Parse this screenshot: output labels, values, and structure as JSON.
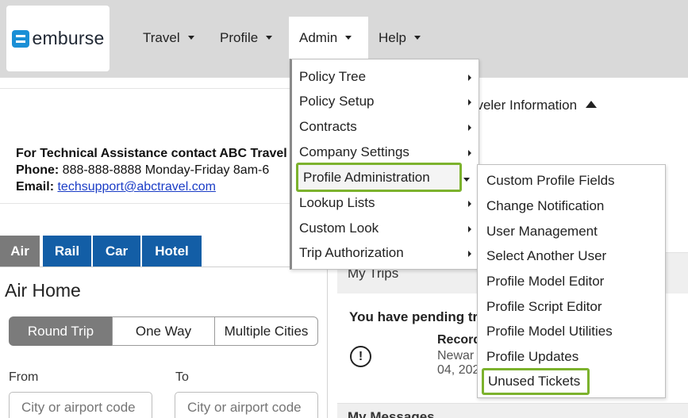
{
  "brand": {
    "name": "emburse",
    "color": "#1a8fd6"
  },
  "nav": {
    "items": [
      {
        "label": "Travel"
      },
      {
        "label": "Profile"
      },
      {
        "label": "Admin"
      },
      {
        "label": "Help"
      }
    ]
  },
  "admin_menu": {
    "items": [
      {
        "label": "Policy Tree"
      },
      {
        "label": "Policy Setup"
      },
      {
        "label": "Contracts"
      },
      {
        "label": "Company Settings"
      },
      {
        "label": "Profile Administration"
      },
      {
        "label": "Lookup Lists"
      },
      {
        "label": "Custom Look"
      },
      {
        "label": "Trip Authorization"
      }
    ],
    "highlight_color": "#7cb22d"
  },
  "profile_admin_submenu": {
    "items": [
      {
        "label": "Custom Profile Fields"
      },
      {
        "label": "Change Notification"
      },
      {
        "label": "User Management"
      },
      {
        "label": "Select Another User"
      },
      {
        "label": "Profile Model Editor"
      },
      {
        "label": "Profile Script Editor"
      },
      {
        "label": "Profile Model Utilities"
      },
      {
        "label": "Profile Updates"
      },
      {
        "label": "Unused Tickets"
      }
    ]
  },
  "traveler_info": {
    "label": "aveler Information"
  },
  "support": {
    "line1": "For Technical Assistance contact ABC Travel",
    "phone_label": "Phone:",
    "phone_value": "888-888-8888 Monday-Friday 8am-6",
    "email_label": "Email:",
    "email_value": "techsupport@abctravel.com"
  },
  "tabs": [
    {
      "label": "Air"
    },
    {
      "label": "Rail"
    },
    {
      "label": "Car"
    },
    {
      "label": "Hotel"
    }
  ],
  "air_home": {
    "title": "Air Home",
    "trip_types": [
      {
        "label": "Round Trip"
      },
      {
        "label": "One Way"
      },
      {
        "label": "Multiple Cities"
      }
    ],
    "from_label": "From",
    "to_label": "To",
    "from_placeholder": "City or airport code",
    "to_placeholder": "City or airport code"
  },
  "trips": {
    "title": "My Trips",
    "pending": "You have pending tri",
    "record_label": "Record",
    "record_line2": "Newar",
    "record_line3": "04, 202",
    "alert_icon": "!"
  },
  "messages": {
    "title": "My Messages"
  },
  "colors": {
    "tab_blue": "#135ea6",
    "tab_gray": "#7a7a7a",
    "topbar": "#d9d9d9"
  }
}
